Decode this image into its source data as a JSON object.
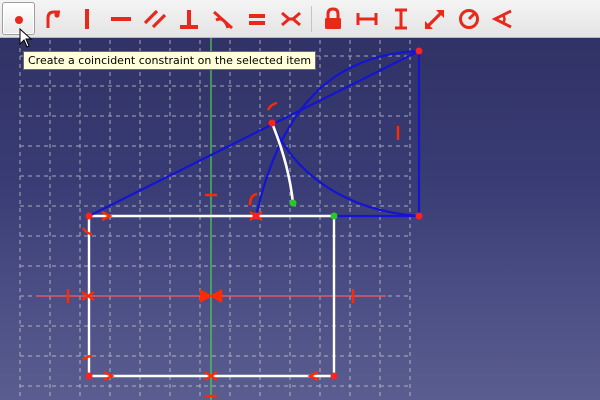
{
  "toolbar": {
    "buttons": [
      {
        "name": "coincident-constraint-button",
        "icon": "point-dot-icon",
        "active": true
      },
      {
        "name": "point-on-object-button",
        "icon": "point-on-object-icon",
        "active": false
      },
      {
        "name": "vertical-constraint-button",
        "icon": "vertical-line-icon",
        "active": false
      },
      {
        "name": "horizontal-constraint-button",
        "icon": "horizontal-line-icon",
        "active": false
      },
      {
        "name": "parallel-constraint-button",
        "icon": "parallel-icon",
        "active": false
      },
      {
        "name": "perpendicular-constraint-button",
        "icon": "perpendicular-icon",
        "active": false
      },
      {
        "name": "tangent-constraint-button",
        "icon": "tangent-icon",
        "active": false
      },
      {
        "name": "equal-constraint-button",
        "icon": "equal-icon",
        "active": false
      },
      {
        "name": "symmetric-constraint-button",
        "icon": "symmetric-icon",
        "active": false
      },
      {
        "name": "lock-constraint-button",
        "icon": "lock-icon",
        "active": false
      },
      {
        "name": "horizontal-distance-button",
        "icon": "horizontal-distance-icon",
        "active": false
      },
      {
        "name": "vertical-distance-button",
        "icon": "vertical-distance-icon",
        "active": false
      },
      {
        "name": "distance-constraint-button",
        "icon": "diagonal-distance-icon",
        "active": false
      },
      {
        "name": "radius-constraint-button",
        "icon": "radius-icon",
        "active": false
      },
      {
        "name": "angle-constraint-button",
        "icon": "angle-icon",
        "active": false
      }
    ],
    "icon_color": "#e8281b"
  },
  "tooltip": {
    "text": "Create a coincident constraint on the selected item"
  },
  "colors": {
    "geometry": "#1414d2",
    "selected_edge": "#ffffff",
    "constraint": "#ff2a00",
    "vertex": "#ff2020",
    "axis_vertical": "#4cd44c",
    "axis_horizontal": "#ff5a5a",
    "grid": "#c9c9c9"
  }
}
